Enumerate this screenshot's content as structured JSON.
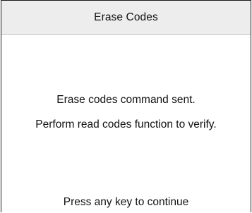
{
  "screen": {
    "title": "Erase Codes",
    "message_line_1": "Erase codes command sent.",
    "message_line_2": "Perform read codes function to verify.",
    "continue_prompt": "Press any key to continue"
  }
}
